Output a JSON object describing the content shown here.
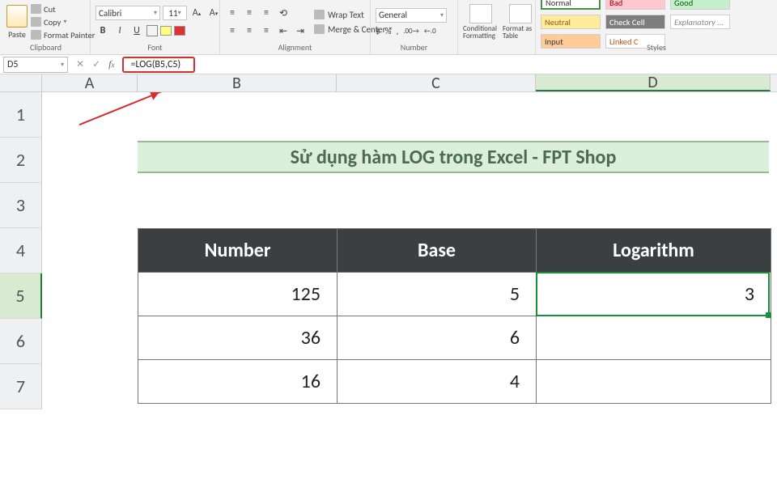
{
  "ribbon": {
    "clipboard": {
      "paste": "Paste",
      "cut": "Cut",
      "copy": "Copy",
      "format_painter": "Format Painter",
      "label": "Clipboard"
    },
    "font": {
      "name": "Calibri",
      "size": "11",
      "label": "Font"
    },
    "alignment": {
      "wrap": "Wrap Text",
      "merge": "Merge & Center",
      "label": "Alignment"
    },
    "number": {
      "format": "General",
      "label": "Number"
    },
    "cond": {
      "cond_fmt": "Conditional Formatting",
      "fmt_table": "Format as Table",
      "style_normal": "Normal",
      "style_bad": "Bad",
      "style_good": "Good",
      "style_neutral": "Neutral",
      "style_check": "Check Cell",
      "style_explan": "Explanatory ...",
      "style_input": "Input",
      "style_linked": "Linked C",
      "label": "Styles"
    }
  },
  "formula_bar": {
    "cell_ref": "D5",
    "formula": "=LOG(B5,C5)"
  },
  "sheet": {
    "col_headers": [
      "A",
      "B",
      "C",
      "D"
    ],
    "row_headers": [
      "1",
      "2",
      "3",
      "4",
      "5",
      "6",
      "7"
    ],
    "title": "Sử dụng hàm LOG trong Excel - FPT Shop",
    "table": {
      "headers": [
        "Number",
        "Base",
        "Logarithm"
      ],
      "rows": [
        {
          "number": "125",
          "base": "5",
          "log": "3"
        },
        {
          "number": "36",
          "base": "6",
          "log": ""
        },
        {
          "number": "16",
          "base": "4",
          "log": ""
        }
      ]
    },
    "selected_cell": "D5"
  },
  "chart_data": {
    "type": "table",
    "title": "Sử dụng hàm LOG trong Excel - FPT Shop",
    "columns": [
      "Number",
      "Base",
      "Logarithm"
    ],
    "rows": [
      [
        125,
        5,
        3
      ],
      [
        36,
        6,
        null
      ],
      [
        16,
        4,
        null
      ]
    ],
    "formula": "=LOG(B5,C5)",
    "formula_cell": "D5"
  }
}
